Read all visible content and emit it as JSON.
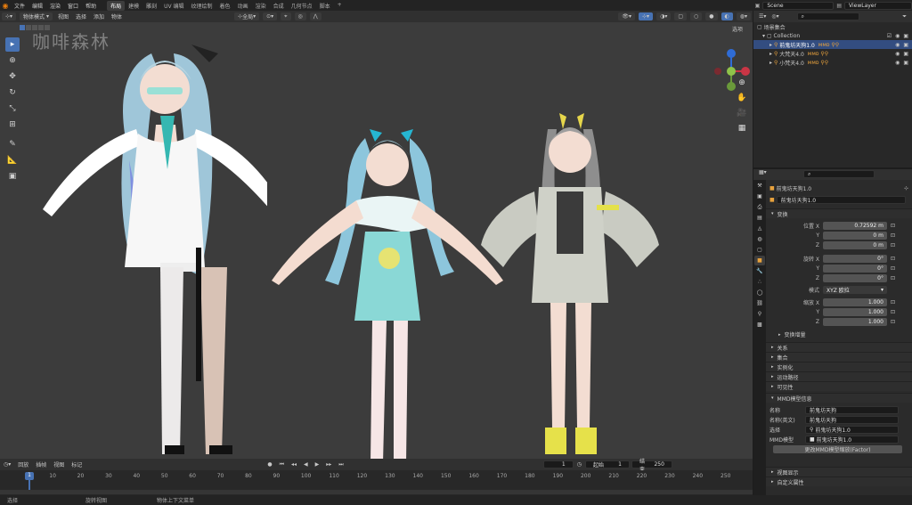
{
  "menu": [
    "文件",
    "编辑",
    "渲染",
    "窗口",
    "帮助"
  ],
  "workspaces": [
    "布局",
    "建模",
    "雕刻",
    "UV 编辑",
    "纹理绘制",
    "着色",
    "动画",
    "渲染",
    "合成",
    "几何节点",
    "脚本"
  ],
  "active_workspace": "布局",
  "scene": "Scene",
  "view_layer": "ViewLayer",
  "viewport_header": {
    "mode": "物体模式",
    "items": [
      "视图",
      "选择",
      "添加",
      "物体"
    ],
    "orientation": "全局",
    "options": "选项"
  },
  "watermark": "咖啡森林",
  "timeline": {
    "menu": [
      "回放",
      "插帧",
      "视图",
      "标记"
    ],
    "current_frame": "1",
    "start_label": "起始",
    "start": "1",
    "end_label": "结束",
    "end": "250",
    "ticks": [
      "1",
      "10",
      "20",
      "30",
      "40",
      "50",
      "60",
      "70",
      "80",
      "90",
      "100",
      "110",
      "120",
      "130",
      "140",
      "150",
      "160",
      "170",
      "180",
      "190",
      "200",
      "210",
      "220",
      "230",
      "240",
      "250"
    ]
  },
  "status": [
    "选择",
    "旋转视图",
    "物体上下文菜单"
  ],
  "outliner": {
    "rows": [
      {
        "label": "场景集合",
        "indent": 0,
        "selected": false
      },
      {
        "label": "Collection",
        "indent": 1,
        "selected": false
      },
      {
        "label": "前鬼坊天狗1.0",
        "indent": 2,
        "selected": true
      },
      {
        "label": "大梵天4.0",
        "indent": 2,
        "selected": false
      },
      {
        "label": "小梵天4.0",
        "indent": 2,
        "selected": false
      }
    ]
  },
  "properties": {
    "object_name": "前鬼坊天狗1.0",
    "data_name": "前鬼坊天狗1.0",
    "transform_title": "变换",
    "location_label": "位置 X",
    "location": [
      "0.72592 m",
      "0 m",
      "0 m"
    ],
    "rotation_label": "旋转 X",
    "rotation": [
      "0°",
      "0°",
      "0°"
    ],
    "mode_label": "模式",
    "mode_value": "XYZ 欧拉",
    "scale_label": "缩放 X",
    "scale": [
      "1.000",
      "1.000",
      "1.000"
    ],
    "delta": "变换增量",
    "sections": [
      "关系",
      "集合",
      "实例化",
      "运动路径",
      "可见性"
    ],
    "mmd_title": "MMD模型信息",
    "mmd_name_label": "名称",
    "mmd_name": "前鬼坊天狗",
    "mmd_name_en_label": "名称(英文)",
    "mmd_name_en": "前鬼坊天狗",
    "mmd_root_label": "选择",
    "mmd_root": "前鬼坊天狗1.0",
    "mmd_model_label": "MMD模型",
    "mmd_model": "前鬼坊天狗1.0",
    "mmd_button": "更改MMD模型缩放(Factor)",
    "bottom_sections": [
      "视图显示",
      "自定义属性"
    ]
  },
  "colors": {
    "accent": "#4772b3",
    "selection": "#334d80",
    "viewport": "#3c3c3c"
  }
}
